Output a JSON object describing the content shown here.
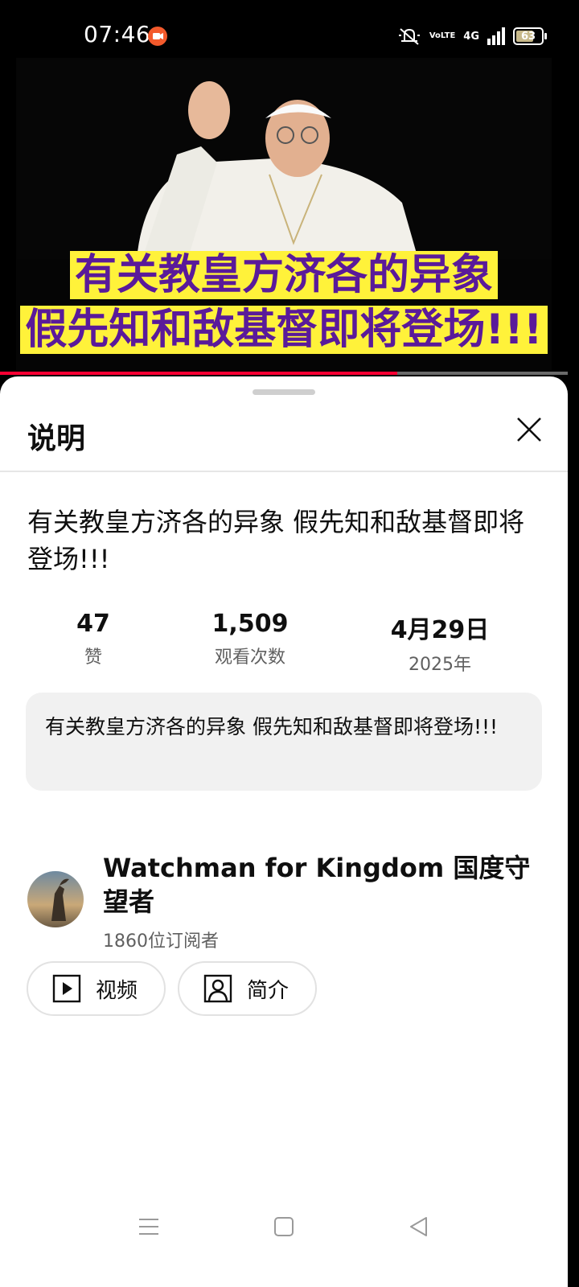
{
  "status_bar": {
    "time": "07:46",
    "battery_level": "63",
    "network": "4G",
    "volte": "VoLTE",
    "icons": [
      "screen-record-icon",
      "mute-icon",
      "volte-icon",
      "signal-icon",
      "battery-icon"
    ]
  },
  "video": {
    "caption_line1": "有关教皇方济各的异象",
    "caption_line2": "假先知和敌基督即将登场!!!",
    "progress_fraction": 0.7
  },
  "sheet": {
    "title": "说明",
    "video_title": "有关教皇方济各的异象 假先知和敌基督即将登场!!!",
    "stats": [
      {
        "value": "47",
        "label": "赞"
      },
      {
        "value": "1,509",
        "label": "观看次数"
      },
      {
        "value": "4月29日",
        "label": "2025年"
      }
    ],
    "description": "有关教皇方济各的异象 假先知和敌基督即将登场!!!",
    "channel": {
      "name": "Watchman for Kingdom 国度守望者",
      "subscribers": "1860位订阅者"
    },
    "buttons": {
      "videos": "视频",
      "about": "简介"
    }
  },
  "colors": {
    "progress": "#ff0033",
    "caption_bg": "#fff23a",
    "caption_text": "#5a1a9a"
  }
}
